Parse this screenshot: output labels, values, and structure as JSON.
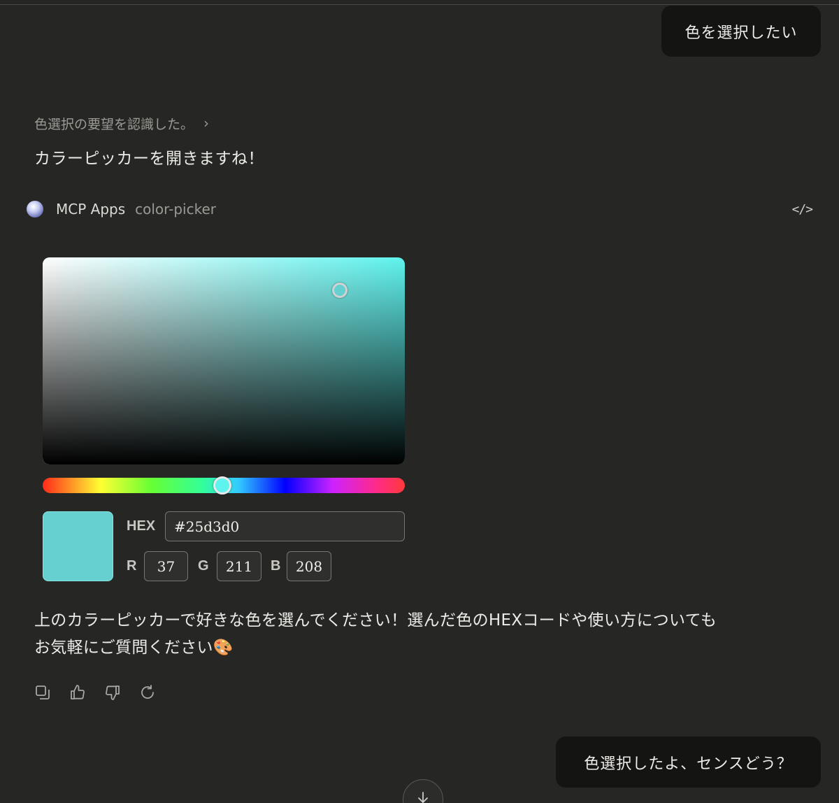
{
  "messages": {
    "user_1": "色を選択したい",
    "thinking_summary": "色選択の要望を認識した。",
    "assistant_intro": "カラーピッカーを開きますね！",
    "assistant_outro_line1": "上のカラーピッカーで好きな色を選んでください！選んだ色のHEXコードや使い方についても",
    "assistant_outro_line2": "お気軽にご質問ください🎨",
    "user_2": "色選択したよ、センスどう？"
  },
  "tool": {
    "name": "MCP Apps",
    "subtitle": "color-picker",
    "code_icon": "</>"
  },
  "picker": {
    "hue_color": "#5ff3ee",
    "saturation": 0.82,
    "value": 0.84,
    "hue_position": 0.497,
    "selected_color": "#66d0d0",
    "hex_label": "HEX",
    "hex_value": "#25d3d0",
    "r_label": "R",
    "g_label": "G",
    "b_label": "B",
    "r_value": "37",
    "g_value": "211",
    "b_value": "208"
  },
  "icons": {
    "copy": "copy-icon",
    "thumbs_up": "thumbs-up-icon",
    "thumbs_down": "thumbs-down-icon",
    "retry": "retry-icon",
    "scroll_down": "arrow-down-icon"
  }
}
